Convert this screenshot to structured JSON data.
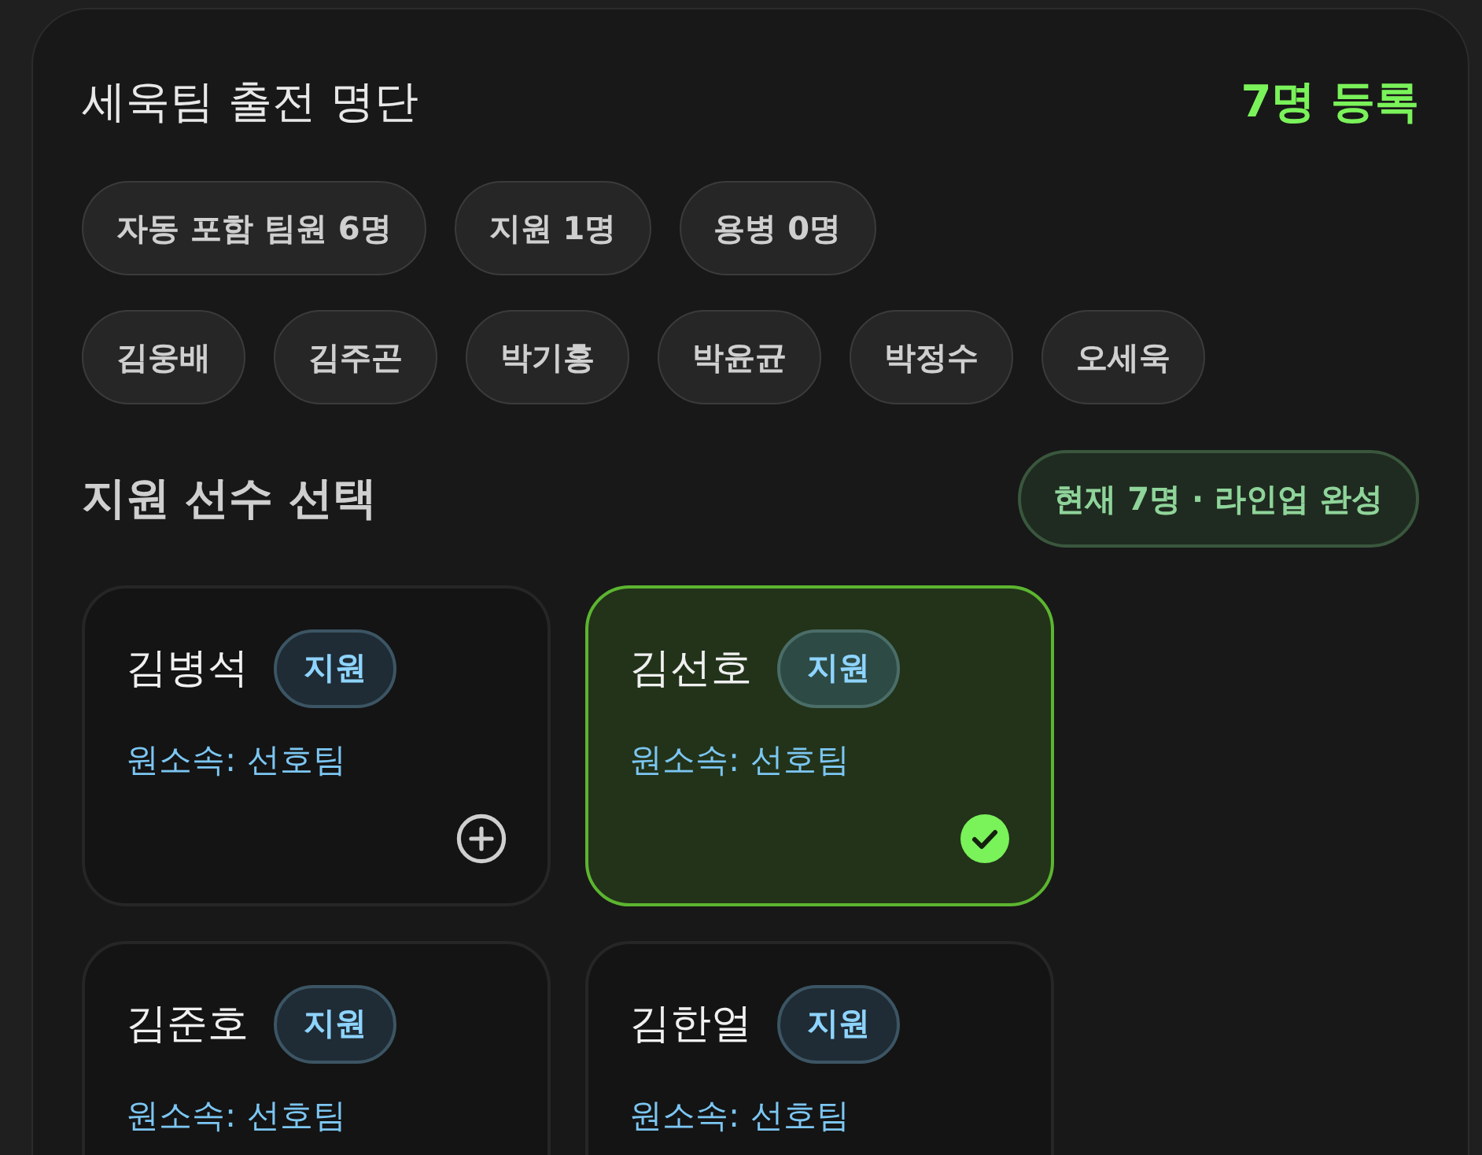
{
  "roster": {
    "title": "세욱팀 출전 명단",
    "count": "7명 등록",
    "summary_chips": [
      "자동 포함 팀원 6명",
      "지원 1명",
      "용병 0명"
    ],
    "member_chips": [
      "김웅배",
      "김주곤",
      "박기홍",
      "박윤균",
      "박정수",
      "오세욱"
    ]
  },
  "support": {
    "heading": "지원 선수 선택",
    "status": "현재 7명 · 라인업 완성",
    "players": [
      {
        "name": "김병석",
        "tag": "지원",
        "affiliation": "원소속: 선호팀",
        "selected": false
      },
      {
        "name": "김선호",
        "tag": "지원",
        "affiliation": "원소속: 선호팀",
        "selected": true
      },
      {
        "name": "김준호",
        "tag": "지원",
        "affiliation": "원소속: 선호팀",
        "selected": false
      },
      {
        "name": "김한얼",
        "tag": "지원",
        "affiliation": "원소속: 선호팀",
        "selected": false
      }
    ]
  }
}
